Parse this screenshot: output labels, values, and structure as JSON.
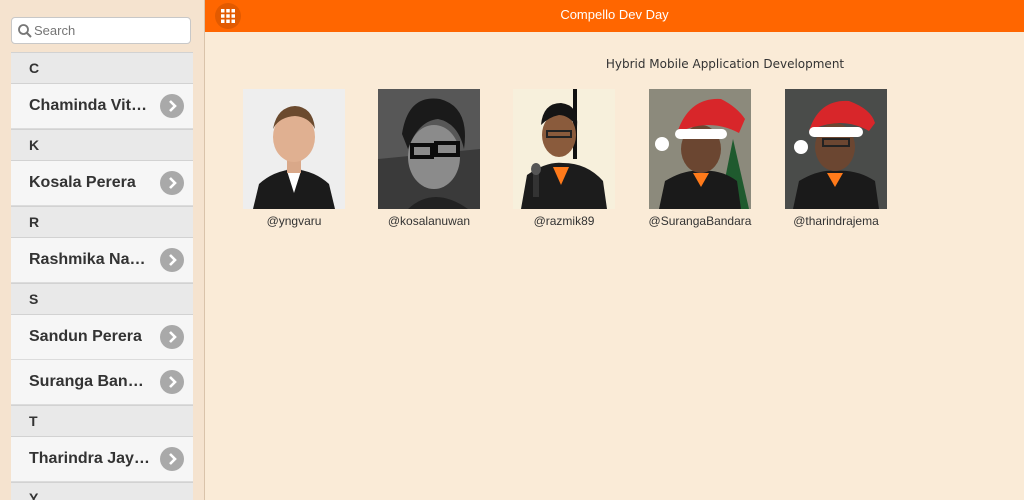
{
  "header": {
    "title": "Compello Dev Day",
    "menu_icon": "grid-icon"
  },
  "search": {
    "placeholder": "Search",
    "value": ""
  },
  "sidebar": {
    "groups": [
      {
        "letter": "C",
        "items": [
          {
            "label": "Chaminda Vit…"
          }
        ]
      },
      {
        "letter": "K",
        "items": [
          {
            "label": "Kosala Perera"
          }
        ]
      },
      {
        "letter": "R",
        "items": [
          {
            "label": "Rashmika Na…"
          }
        ]
      },
      {
        "letter": "S",
        "items": [
          {
            "label": "Sandun Perera"
          },
          {
            "label": "Suranga Ban…"
          }
        ]
      },
      {
        "letter": "T",
        "items": [
          {
            "label": "Tharindra Jay…"
          }
        ]
      },
      {
        "letter": "Y",
        "items": []
      }
    ]
  },
  "main": {
    "subtitle": "Hybrid Mobile Application Development",
    "speakers": [
      {
        "handle": "@yngvaru"
      },
      {
        "handle": "@kosalanuwan"
      },
      {
        "handle": "@razmik89"
      },
      {
        "handle": "@SurangaBandara"
      },
      {
        "handle": "@tharindrajema"
      }
    ]
  },
  "colors": {
    "accent": "#ff6600",
    "background": "#faebd7"
  }
}
